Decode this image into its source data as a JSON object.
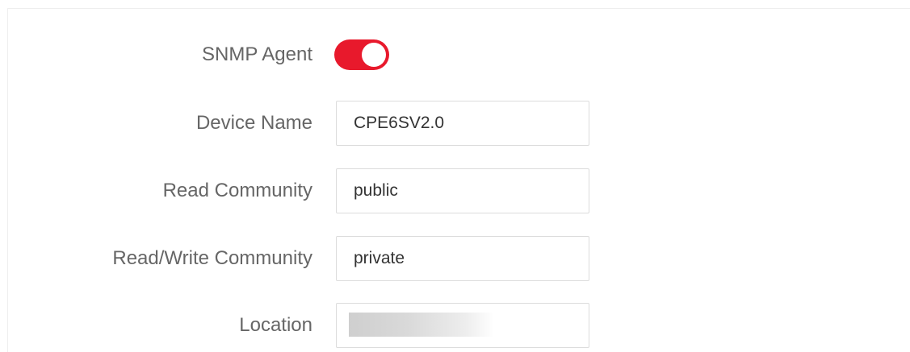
{
  "form": {
    "snmp_agent": {
      "label": "SNMP Agent",
      "enabled": true,
      "accent_color": "#e8192c"
    },
    "device_name": {
      "label": "Device Name",
      "value": "CPE6SV2.0"
    },
    "read_community": {
      "label": "Read Community",
      "value": "public"
    },
    "read_write_community": {
      "label": "Read/Write Community",
      "value": "private"
    },
    "location": {
      "label": "Location"
    }
  }
}
